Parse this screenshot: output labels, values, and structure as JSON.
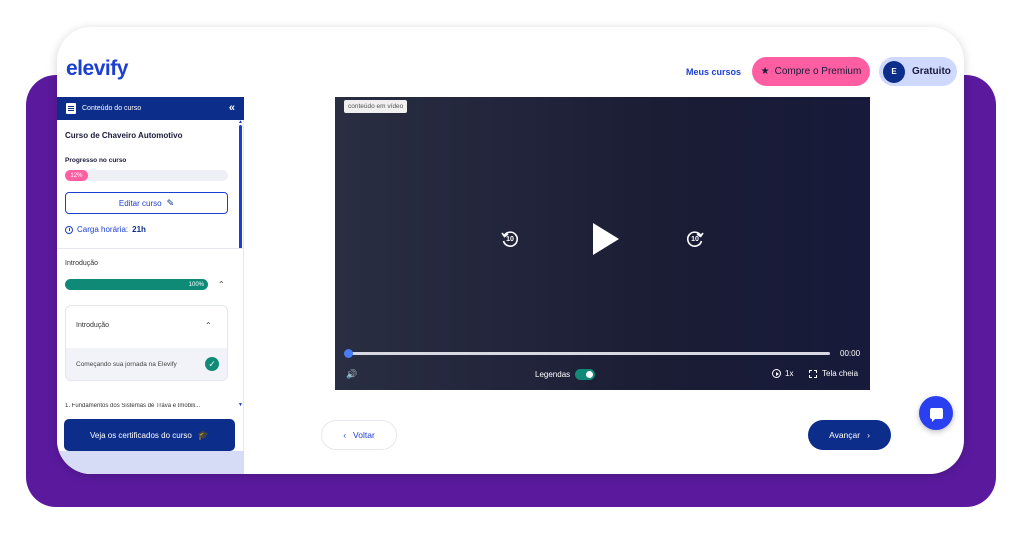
{
  "header": {
    "logo": "elevify",
    "nav_link": "Meus cursos",
    "premium_label": "Compre o Premium",
    "avatar_initial": "E",
    "plan_label": "Gratuito"
  },
  "sidebar": {
    "header_title": "Conteúdo do curso",
    "collapse_glyph": "«",
    "course_title": "Curso de Chaveiro Automotivo",
    "progress_label": "Progresso no curso",
    "progress_text": "12%",
    "progress_value": 12,
    "edit_label": "Editar curso",
    "hours_label": "Carga horária:",
    "hours_value": "21h",
    "module": {
      "label": "Introdução",
      "progress_text": "100%",
      "progress_value": 100,
      "submodule": {
        "label": "Introdução",
        "lesson": "Começando sua jornada na Elevify",
        "completed": true
      }
    },
    "next_module": "1.  Fundamentos dos Sistemas de Trava e Imobili...",
    "cert_label": "Veja os certificados do curso"
  },
  "video": {
    "tag": "conteúdo em vídeo",
    "rewind_seconds": "10",
    "forward_seconds": "10",
    "time": "00:00",
    "captions_label": "Legendas",
    "captions_on": true,
    "speed": "1x",
    "fullscreen_label": "Tela cheia"
  },
  "footer_nav": {
    "back_label": "Voltar",
    "next_label": "Avançar"
  },
  "colors": {
    "primary": "#0c2e8a",
    "accent_pink": "#ff5fa2",
    "success": "#0e8a77",
    "purple_bg": "#5b1a9e"
  }
}
